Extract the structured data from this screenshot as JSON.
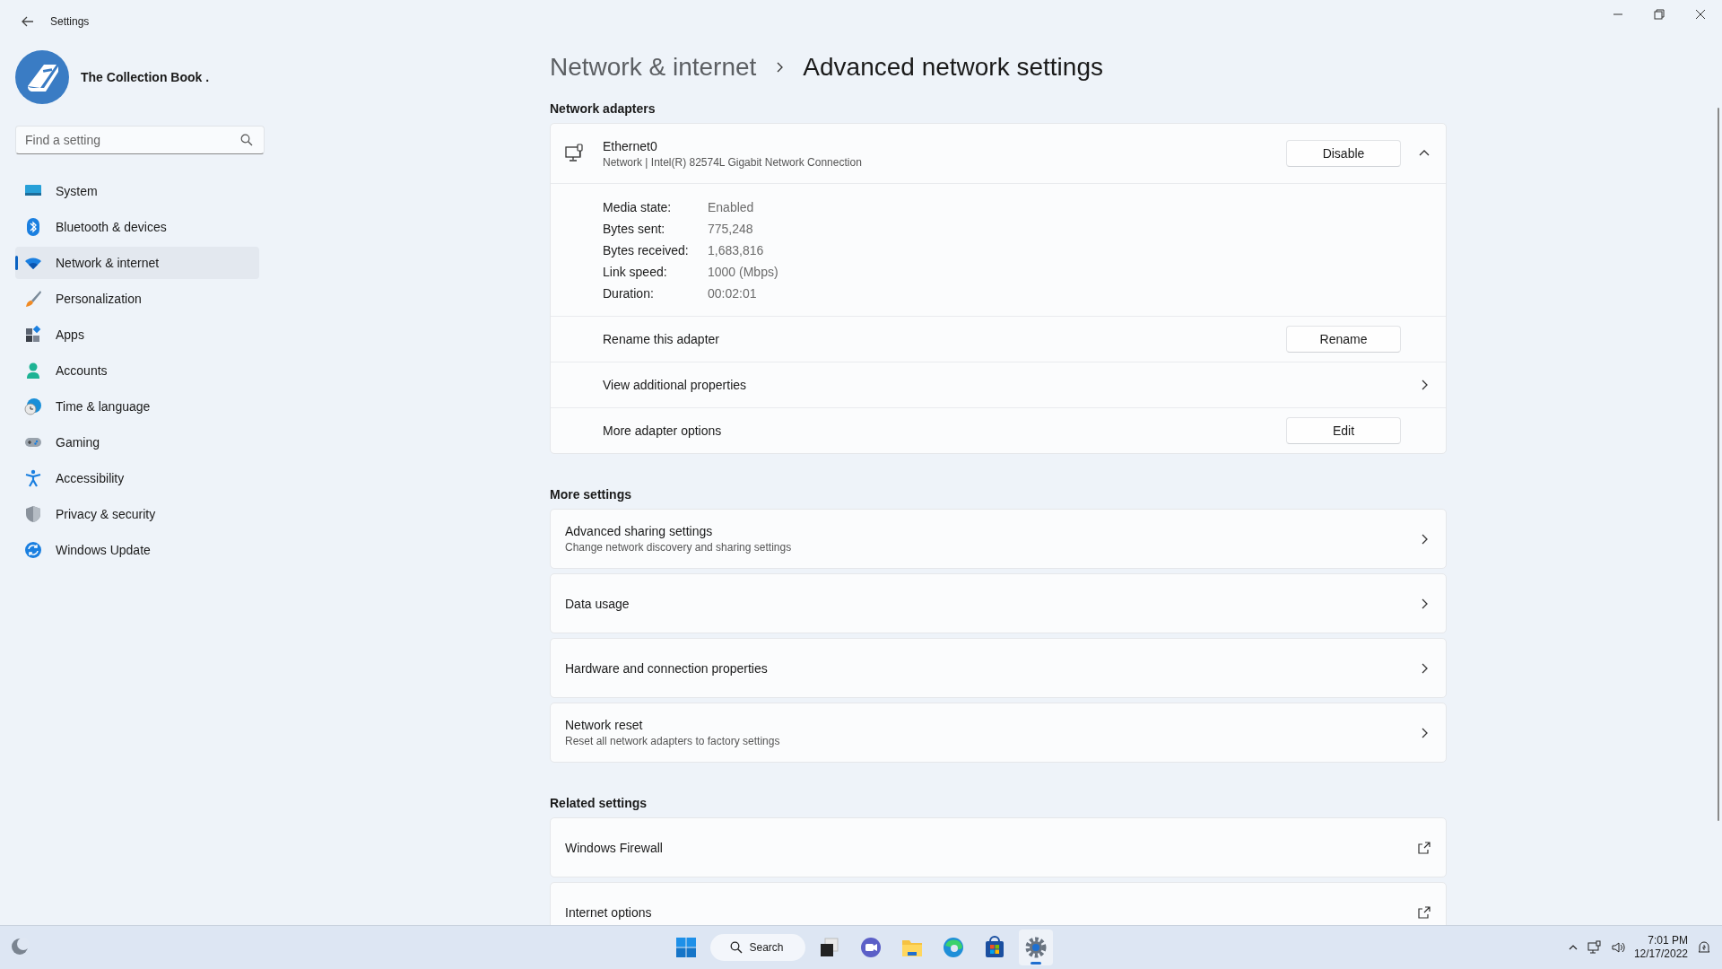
{
  "window": {
    "title": "Settings"
  },
  "profile": {
    "name": "The Collection Book ."
  },
  "search": {
    "placeholder": "Find a setting"
  },
  "nav": [
    {
      "label": "System",
      "kind": "system",
      "selected": false
    },
    {
      "label": "Bluetooth & devices",
      "kind": "bluetooth",
      "selected": false
    },
    {
      "label": "Network & internet",
      "kind": "wifi",
      "selected": true
    },
    {
      "label": "Personalization",
      "kind": "brush",
      "selected": false
    },
    {
      "label": "Apps",
      "kind": "apps",
      "selected": false
    },
    {
      "label": "Accounts",
      "kind": "person",
      "selected": false
    },
    {
      "label": "Time & language",
      "kind": "globe",
      "selected": false
    },
    {
      "label": "Gaming",
      "kind": "gamepad",
      "selected": false
    },
    {
      "label": "Accessibility",
      "kind": "accessibility",
      "selected": false
    },
    {
      "label": "Privacy & security",
      "kind": "shield",
      "selected": false
    },
    {
      "label": "Windows Update",
      "kind": "update",
      "selected": false
    }
  ],
  "breadcrumb": {
    "parent": "Network & internet",
    "current": "Advanced network settings"
  },
  "adapters": {
    "title": "Network adapters",
    "items": [
      {
        "name": "Ethernet0",
        "description": "Network | Intel(R) 82574L Gigabit Network Connection",
        "button": "Disable",
        "expanded": true,
        "details": [
          {
            "label": "Media state:",
            "value": "Enabled"
          },
          {
            "label": "Bytes sent:",
            "value": "775,248"
          },
          {
            "label": "Bytes received:",
            "value": "1,683,816"
          },
          {
            "label": "Link speed:",
            "value": "1000 (Mbps)"
          },
          {
            "label": "Duration:",
            "value": "00:02:01"
          }
        ],
        "actions": [
          {
            "label": "Rename this adapter",
            "kind": "button",
            "button": "Rename"
          },
          {
            "label": "View additional properties",
            "kind": "chevron"
          },
          {
            "label": "More adapter options",
            "kind": "button",
            "button": "Edit"
          }
        ]
      }
    ]
  },
  "more_settings": {
    "title": "More settings",
    "items": [
      {
        "title": "Advanced sharing settings",
        "subtitle": "Change network discovery and sharing settings",
        "kind": "chevron"
      },
      {
        "title": "Data usage",
        "kind": "chevron"
      },
      {
        "title": "Hardware and connection properties",
        "kind": "chevron"
      },
      {
        "title": "Network reset",
        "subtitle": "Reset all network adapters to factory settings",
        "kind": "chevron"
      }
    ]
  },
  "related_settings": {
    "title": "Related settings",
    "items": [
      {
        "title": "Windows Firewall",
        "kind": "external"
      },
      {
        "title": "Internet options",
        "kind": "external"
      }
    ]
  },
  "taskbar": {
    "search": "Search",
    "apps": [
      {
        "kind": "start",
        "selected": false
      },
      {
        "kind": "search"
      },
      {
        "kind": "taskview",
        "selected": false
      },
      {
        "kind": "chat",
        "selected": false
      },
      {
        "kind": "explorer",
        "selected": false
      },
      {
        "kind": "browser",
        "selected": false
      },
      {
        "kind": "store",
        "selected": false
      },
      {
        "kind": "settings",
        "selected": true
      }
    ],
    "time": "7:01 PM",
    "date": "12/17/2022"
  }
}
